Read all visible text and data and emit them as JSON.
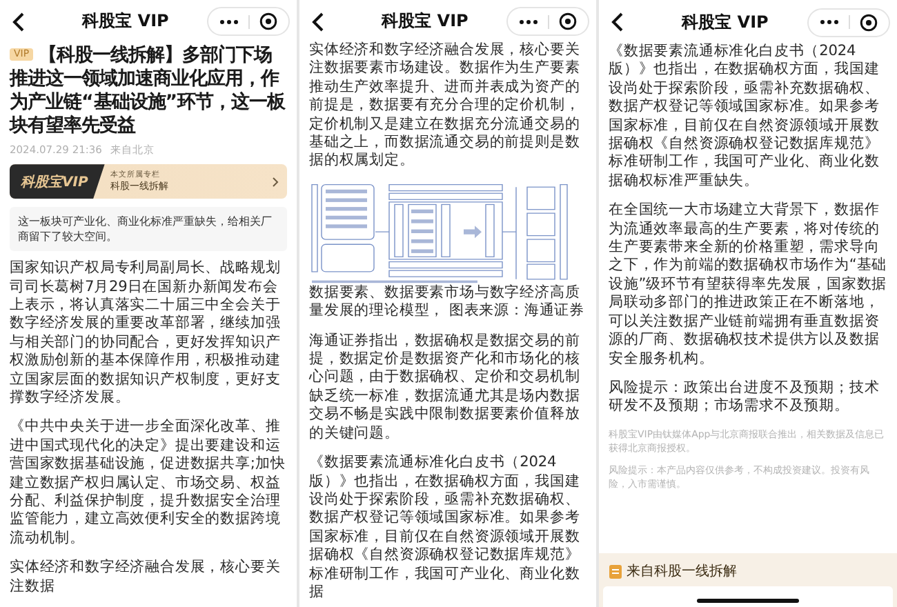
{
  "panels": [
    {
      "nav_title": "科股宝 VIP",
      "blocks": [
        {
          "kind": "headline",
          "badge": "VIP",
          "text": "【科股一线拆解】多部门下场推进这一领域加速商业化应用，作为产业链“基础设施”环节，这一板块有望率先受益"
        },
        {
          "kind": "meta",
          "date": "2024.07.29 21:36",
          "location": "来自北京"
        },
        {
          "kind": "column_banner",
          "logo": "科股宝VIP",
          "label": "本文所属专栏",
          "name": "科股一线拆解"
        },
        {
          "kind": "quote",
          "text": "这一板块可产业化、商业化标准严重缺失，给相关厂商留下了较大空间。"
        },
        {
          "kind": "paragraph",
          "text": "国家知识产权局专利局副局长、战略规划司司长葛树7月29日在国新办新闻发布会上表示，将认真落实二十届三中全会关于数字经济发展的重要改革部署，继续加强与相关部门的协同配合，更好发挥知识产权激励创新的基本保障作用，积极推动建立国家层面的数据知识产权制度，更好支撑数字经济发展。"
        },
        {
          "kind": "paragraph",
          "text": "《中共中央关于进一步全面深化改革、推进中国式现代化的决定》提出要建设和运营国家数据基础设施，促进数据共享;加快建立数据产权归属认定、市场交易、权益分配、利益保护制度，提升数据安全治理监管能力，建立高效便利安全的数据跨境流动机制。"
        },
        {
          "kind": "paragraph",
          "text": "实体经济和数字经济融合发展，核心要关注数据"
        }
      ]
    },
    {
      "nav_title": "科股宝 VIP",
      "blocks": [
        {
          "kind": "paragraph",
          "text": "实体经济和数字经济融合发展，核心要关注数据要素市场建设。数据作为生产要素推动生产效率提升、进而并表成为资产的前提是，数据要有充分合理的定价机制，定价机制又是建立在数据充分流通交易的基础之上，而数据流通交易的前提则是数据的权属划定。"
        },
        {
          "kind": "figure"
        },
        {
          "kind": "paragraph",
          "text": "数据要素、数据要素市场与数字经济高质量发展的理论模型， 图表来源：海通证券"
        },
        {
          "kind": "paragraph",
          "text": "海通证券指出，数据确权是数据交易的前提，数据定价是数据资产化和市场化的核心问题，由于数据确权、定价和交易机制缺乏统一标准，数据流通尤其是场内数据交易不畅是实践中限制数据要素价值释放的关键问题。"
        },
        {
          "kind": "paragraph",
          "text": "《数据要素流通标准化白皮书（2024版）》也指出，在数据确权方面，我国建设尚处于探索阶段，亟需补充数据确权、数据产权登记等领域国家标准。如果参考国家标准，目前仅在自然资源领域开展数据确权《自然资源确权登记数据库规范》标准研制工作，我国可产业化、商业化数据"
        }
      ]
    },
    {
      "nav_title": "科股宝 VIP",
      "blocks": [
        {
          "kind": "paragraph",
          "text": "《数据要素流通标准化白皮书（2024版）》也指出，在数据确权方面，我国建设尚处于探索阶段，亟需补充数据确权、数据产权登记等领域国家标准。如果参考国家标准，目前仅在自然资源领域开展数据确权《自然资源确权登记数据库规范》标准研制工作，我国可产业化、商业化数据确权标准严重缺失。"
        },
        {
          "kind": "paragraph",
          "text": "在全国统一大市场建立大背景下，数据作为流通效率最高的生产要素，将对传统的生产要素带来全新的价格重塑，需求导向之下，作为前端的数据确权市场作为“基础设施”级环节有望获得率先发展，国家数据局联动多部门的推进政策正在不断落地，可以关注数据产业链前端拥有垂直数据资源的厂商、数据确权技术提供方以及数据安全服务机构。"
        },
        {
          "kind": "paragraph",
          "text": "风险提示：政策出台进度不及预期；技术研发不及预期；市场需求不及预期。"
        },
        {
          "kind": "footnote",
          "text": "科股宝VIP由钛媒体App与北京商报联合推出，相关数据及信息已获得北京商报授权。"
        },
        {
          "kind": "footnote",
          "text": "风险提示：本产品内容仅供参考，不构成投资建议。投资有风险，入市需谨慎。"
        },
        {
          "kind": "source",
          "text": "来自科股一线拆解"
        }
      ]
    }
  ]
}
